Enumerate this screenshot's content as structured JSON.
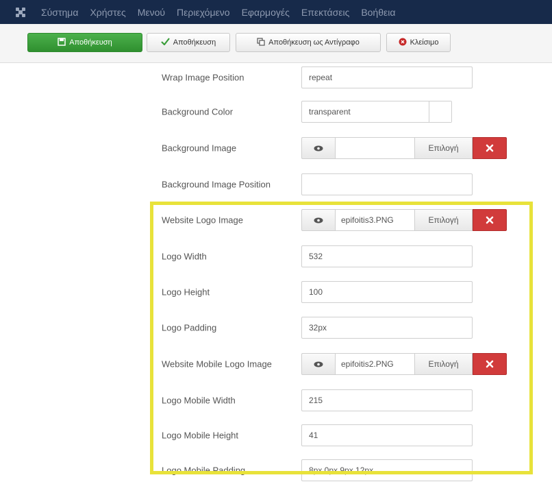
{
  "colors": {
    "topbar": "#172a4a",
    "save_green": "#3a9d3a",
    "clear_red": "#d13b3b",
    "highlight_yellow": "#e8e23a"
  },
  "menu": {
    "items": [
      "Σύστημα",
      "Χρήστες",
      "Μενού",
      "Περιεχόμενο",
      "Εφαρμογές",
      "Επεκτάσεις",
      "Βοήθεια"
    ]
  },
  "toolbar": {
    "save": "Αποθήκευση",
    "save_close": "Αποθήκευση",
    "save_copy": "Αποθήκευση ως Αντίγραφο",
    "close": "Κλείσιμο"
  },
  "form": {
    "wrap_image_position": {
      "label": "Wrap Image Position",
      "value": "repeat"
    },
    "background_color": {
      "label": "Background Color",
      "value": "transparent"
    },
    "background_image": {
      "label": "Background Image",
      "value": "",
      "select": "Επιλογή"
    },
    "background_image_position": {
      "label": "Background Image Position",
      "value": ""
    },
    "website_logo_image": {
      "label": "Website Logo Image",
      "value": "epifoitis3.PNG",
      "select": "Επιλογή"
    },
    "logo_width": {
      "label": "Logo Width",
      "value": "532"
    },
    "logo_height": {
      "label": "Logo Height",
      "value": "100"
    },
    "logo_padding": {
      "label": "Logo Padding",
      "value": "32px"
    },
    "website_mobile_logo_image": {
      "label": "Website Mobile Logo Image",
      "value": "epifoitis2.PNG",
      "select": "Επιλογή"
    },
    "logo_mobile_width": {
      "label": "Logo Mobile Width",
      "value": "215"
    },
    "logo_mobile_height": {
      "label": "Logo Mobile Height",
      "value": "41"
    },
    "logo_mobile_padding": {
      "label": "Logo Mobile Padding",
      "value": "8px 0px 9px 12px"
    }
  },
  "icons": {
    "joomla": "joomla-logo-icon",
    "save": "save-icon",
    "check": "check-icon",
    "copy": "copy-icon",
    "close": "close-circle-icon",
    "eye": "eye-icon",
    "clear": "x-icon"
  }
}
